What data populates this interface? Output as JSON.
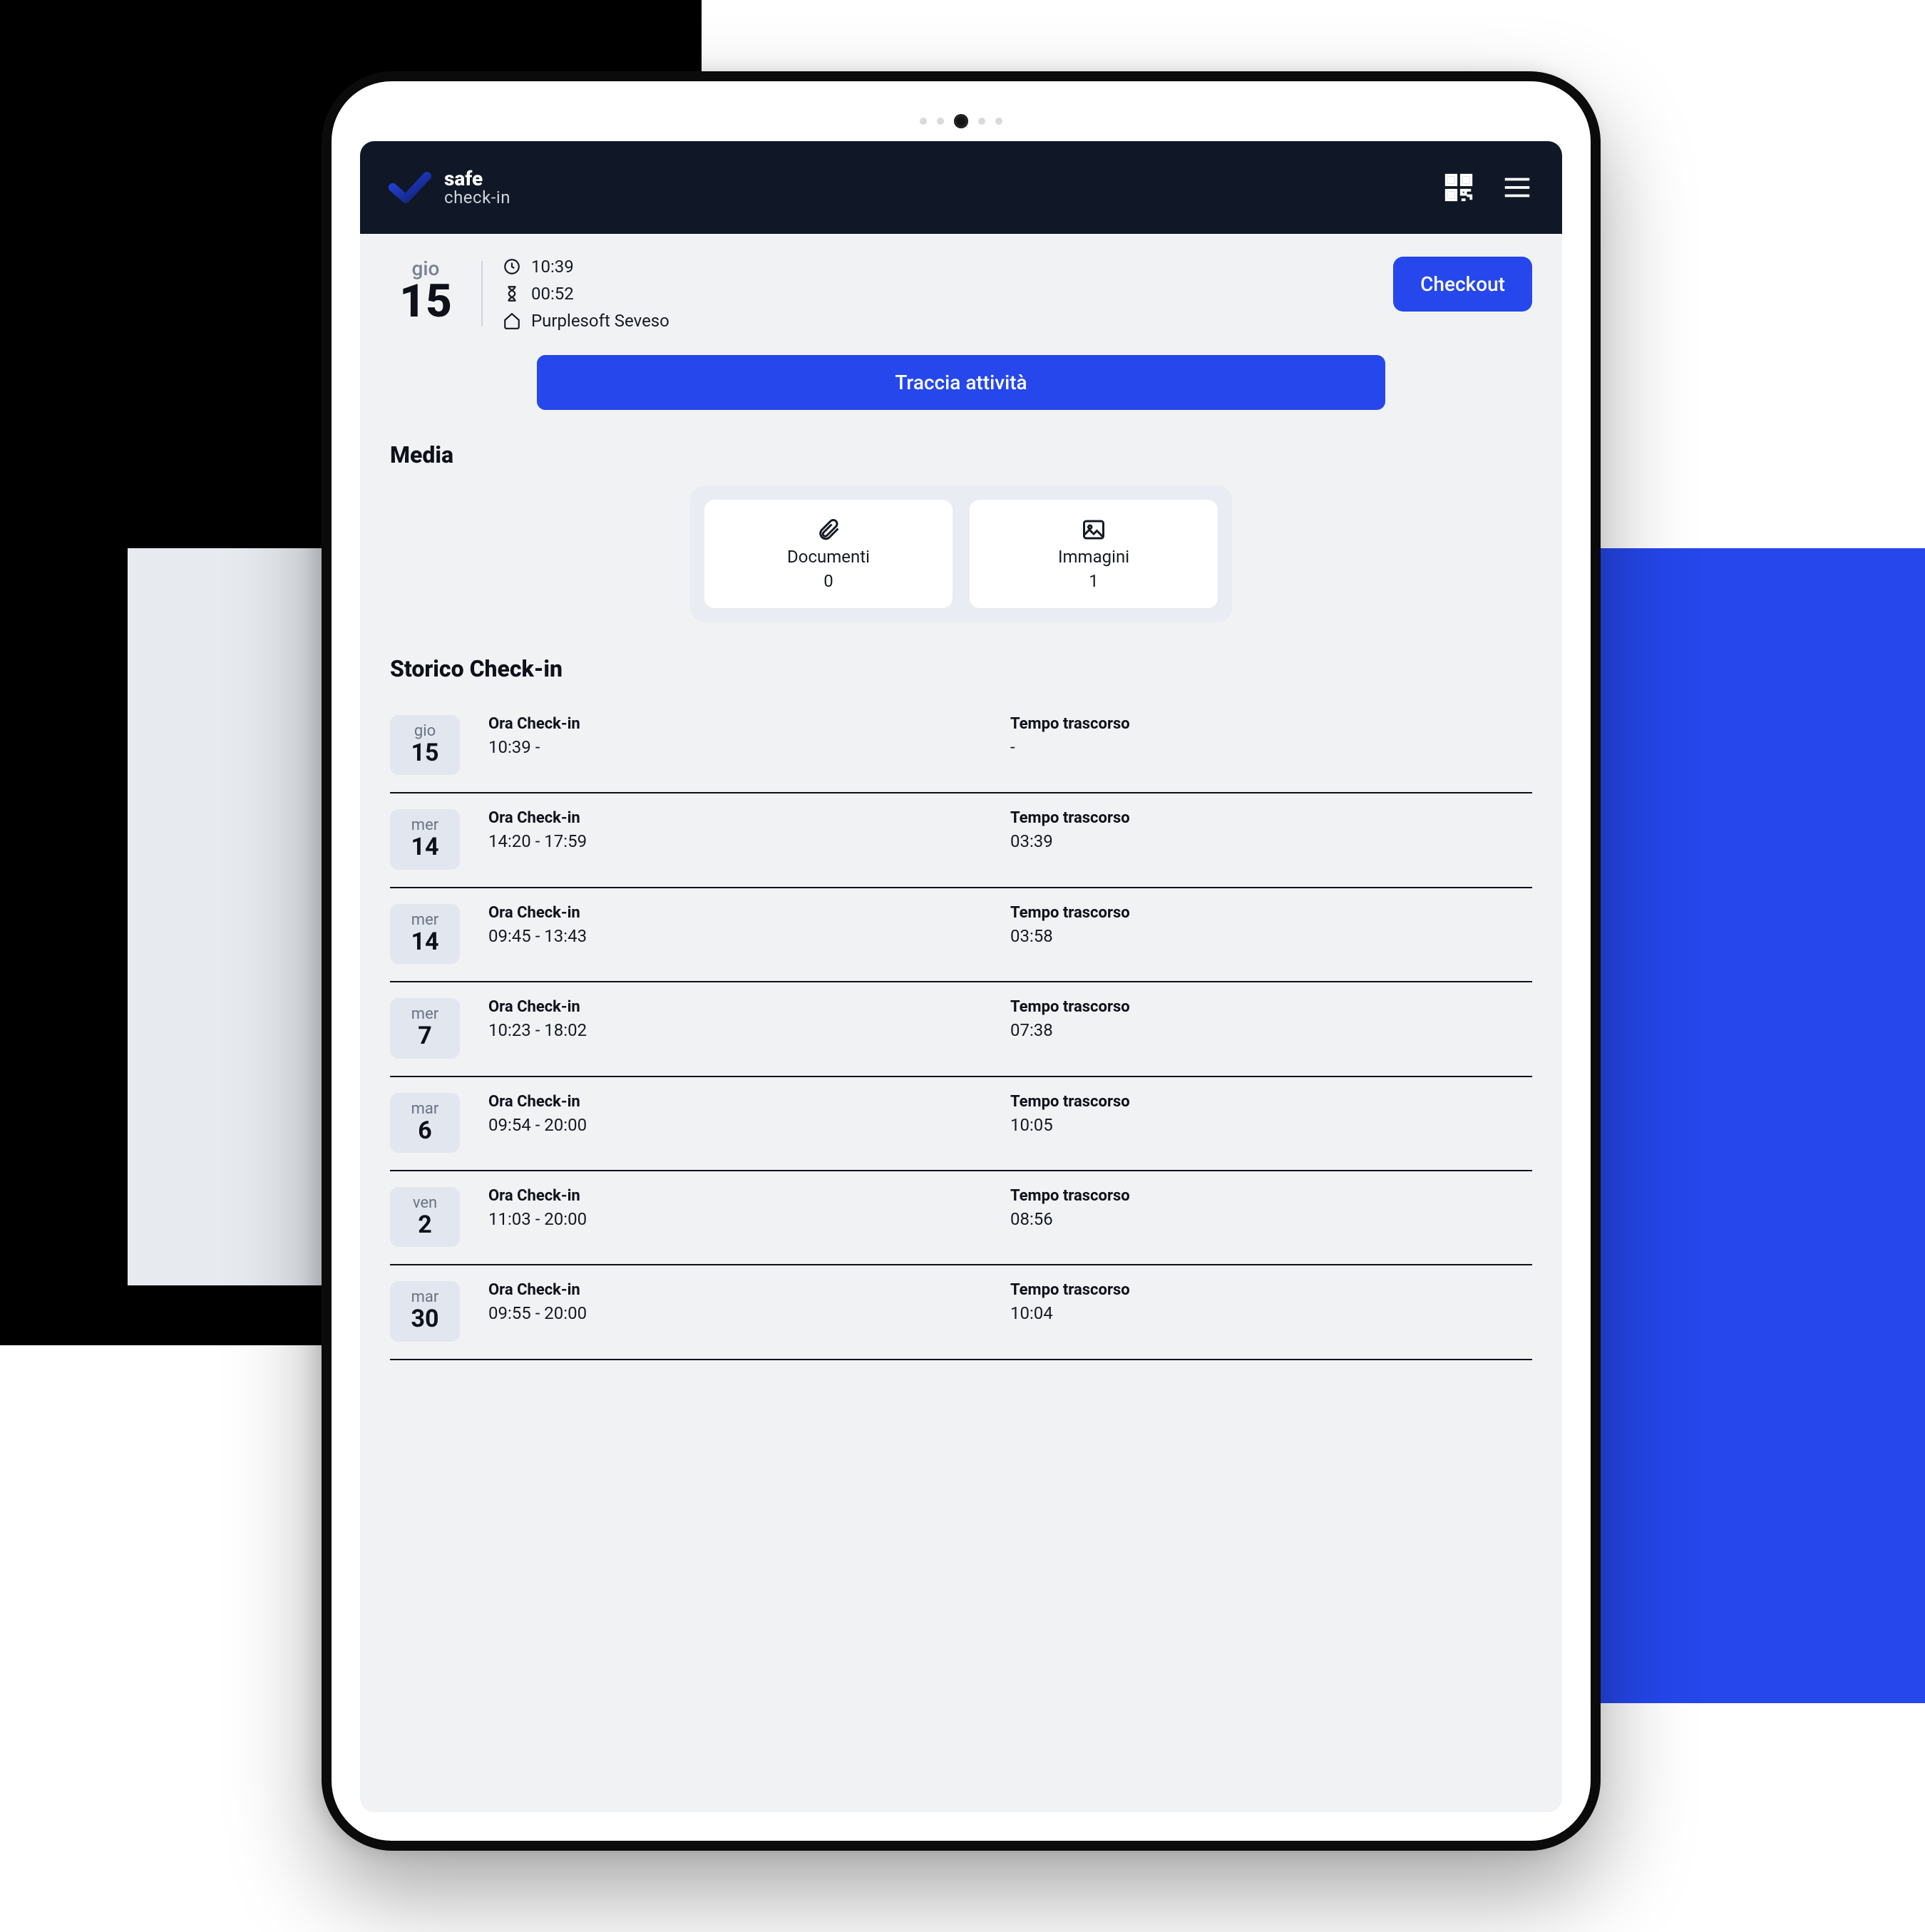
{
  "brand": {
    "line1": "safe",
    "line2": "check-in"
  },
  "summary": {
    "weekday": "gio",
    "day": "15",
    "clock": "10:39",
    "elapsed": "00:52",
    "location": "Purplesoft Seveso"
  },
  "buttons": {
    "checkout": "Checkout",
    "track": "Traccia attività"
  },
  "sections": {
    "media": "Media",
    "history": "Storico Check-in"
  },
  "media": {
    "documents": {
      "label": "Documenti",
      "count": "0"
    },
    "images": {
      "label": "Immagini",
      "count": "1"
    }
  },
  "labels": {
    "checkin_time": "Ora Check-in",
    "elapsed_time": "Tempo trascorso"
  },
  "history": [
    {
      "weekday": "gio",
      "day": "15",
      "time": "10:39 -",
      "elapsed": "-"
    },
    {
      "weekday": "mer",
      "day": "14",
      "time": "14:20 - 17:59",
      "elapsed": "03:39"
    },
    {
      "weekday": "mer",
      "day": "14",
      "time": "09:45 - 13:43",
      "elapsed": "03:58"
    },
    {
      "weekday": "mer",
      "day": "7",
      "time": "10:23 - 18:02",
      "elapsed": "07:38"
    },
    {
      "weekday": "mar",
      "day": "6",
      "time": "09:54 - 20:00",
      "elapsed": "10:05"
    },
    {
      "weekday": "ven",
      "day": "2",
      "time": "11:03 - 20:00",
      "elapsed": "08:56"
    },
    {
      "weekday": "mar",
      "day": "30",
      "time": "09:55 - 20:00",
      "elapsed": "10:04"
    }
  ]
}
